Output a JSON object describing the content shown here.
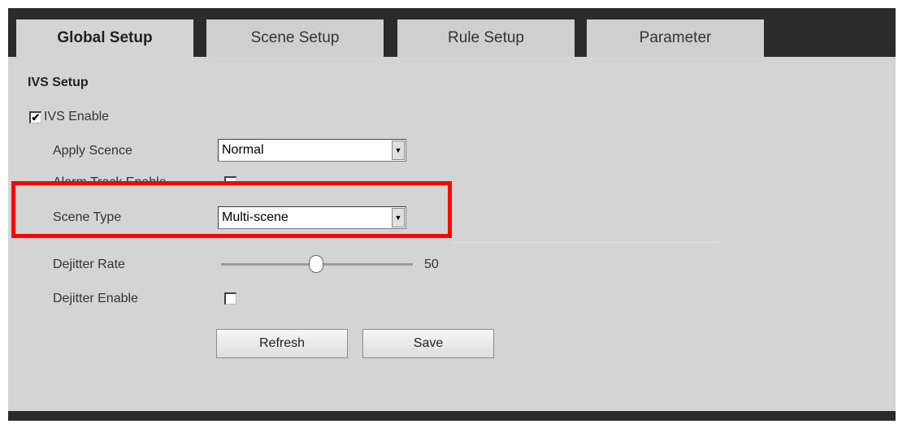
{
  "tabs": [
    {
      "label": "Global Setup",
      "active": true
    },
    {
      "label": "Scene Setup",
      "active": false
    },
    {
      "label": "Rule Setup",
      "active": false
    },
    {
      "label": "Parameter",
      "active": false
    }
  ],
  "section": {
    "title": "IVS Setup"
  },
  "ivs_enable": {
    "label": "IVS Enable",
    "checked": true,
    "check_glyph": "✔"
  },
  "apply_scene": {
    "label": "Apply Scence",
    "value": "Normal"
  },
  "alarm_track": {
    "label": "Alarm Track Enable",
    "checked": false
  },
  "scene_type": {
    "label": "Scene Type",
    "value": "Multi-scene"
  },
  "dejitter_rate": {
    "label": "Dejitter Rate",
    "value": 50,
    "value_text": "50"
  },
  "dejitter_enable": {
    "label": "Dejitter Enable",
    "checked": false
  },
  "buttons": {
    "refresh": "Refresh",
    "save": "Save"
  },
  "colors": {
    "highlight": "#ff0000",
    "tab_bar": "#2b2b2b",
    "panel": "#d4d4d4"
  },
  "icons": {
    "select_arrow": "chevron-down-icon",
    "checkmark": "checkmark-icon"
  }
}
